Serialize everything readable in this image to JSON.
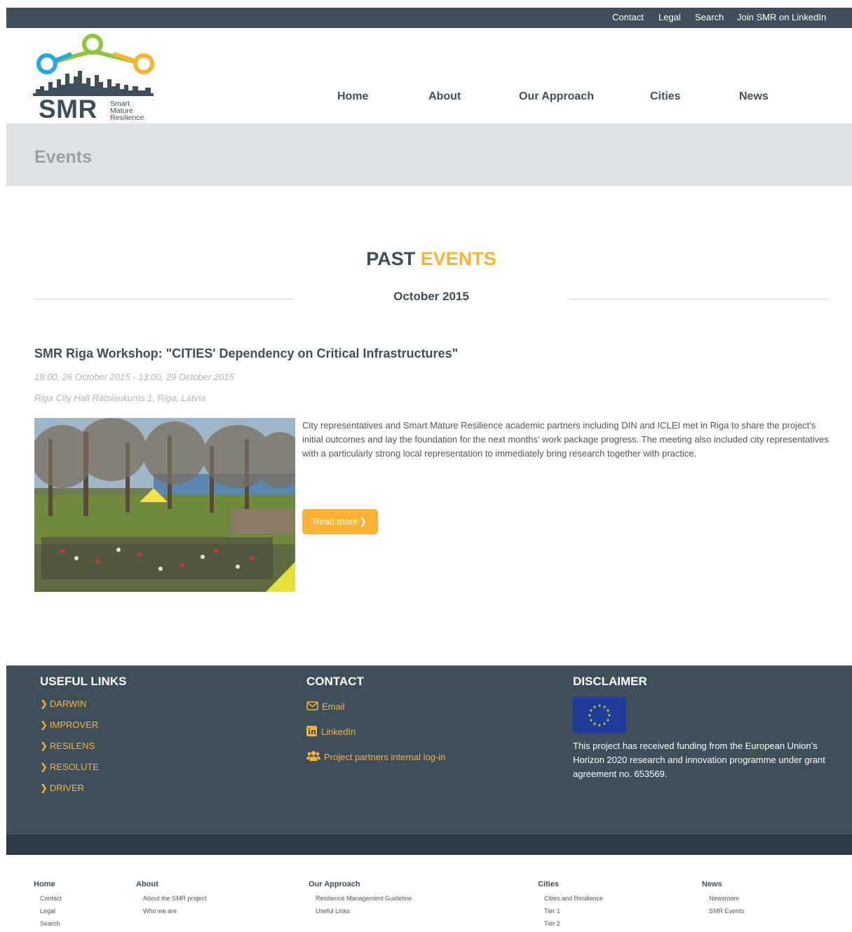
{
  "topbar": {
    "links": [
      "Contact",
      "Legal",
      "Search",
      "Join SMR on LinkedIn"
    ]
  },
  "logo": {
    "text": "SMR",
    "subtitle_lines": [
      "Smart",
      "Mature",
      "Resilience"
    ]
  },
  "nav": {
    "items": [
      "Home",
      "About",
      "Our Approach",
      "Cities",
      "News"
    ]
  },
  "banner": {
    "title": "Events"
  },
  "past_events": {
    "title_part1": "PAST",
    "title_part2": "EVENTS",
    "month": "October 2015"
  },
  "event": {
    "title": "SMR Riga Workshop: \"CITIES' Dependency on Critical Infrastructures\"",
    "datetime": "18:00, 26 October 2015 - 13:00, 29 October 2015",
    "location": "Riga City Hall Rātslaukums 1, Rīga, Latvia",
    "description": "City representatives and Smart Mature Resilience academic partners including DIN and ICLEI met in Riga to share the project's initial outcomes and lay the foundation for the next months' work package progress. The meeting also included city representatives with a particularly strong local representation to immediately bring research together with practice.",
    "read_more": "Read more"
  },
  "footer": {
    "useful_links": {
      "heading": "USEFUL LINKS",
      "items": [
        "DARWIN",
        "IMPROVER",
        "RESILENS",
        "RESOLUTE",
        "DRIVER"
      ]
    },
    "contact": {
      "heading": "CONTACT",
      "items": [
        "Email",
        "LinkedIn",
        "Project partners internal log-in"
      ]
    },
    "disclaimer": {
      "heading": "DISCLAIMER",
      "text": "This project has received funding from the European Union’s Horizon 2020 research and innovation programme under grant agreement no. 653569."
    }
  },
  "sitemap": {
    "columns": [
      {
        "heading": "Home",
        "items": [
          "Contact",
          "Legal",
          "Search"
        ]
      },
      {
        "heading": "About",
        "items": [
          "About the SMR project",
          "Who we are"
        ]
      },
      {
        "heading": "Our Approach",
        "items": [
          "Resilience Management Guideline",
          "Useful Links"
        ]
      },
      {
        "heading": "Cities",
        "items": [
          "Cities and Resilience",
          "Tier 1",
          "Tier 2"
        ]
      },
      {
        "heading": "News",
        "items": [
          "Newsroom",
          "SMR Events"
        ]
      }
    ]
  },
  "colors": {
    "dark": "#3f4f5a",
    "accent": "#f9b233",
    "banner_bg": "#dfe3e5"
  }
}
